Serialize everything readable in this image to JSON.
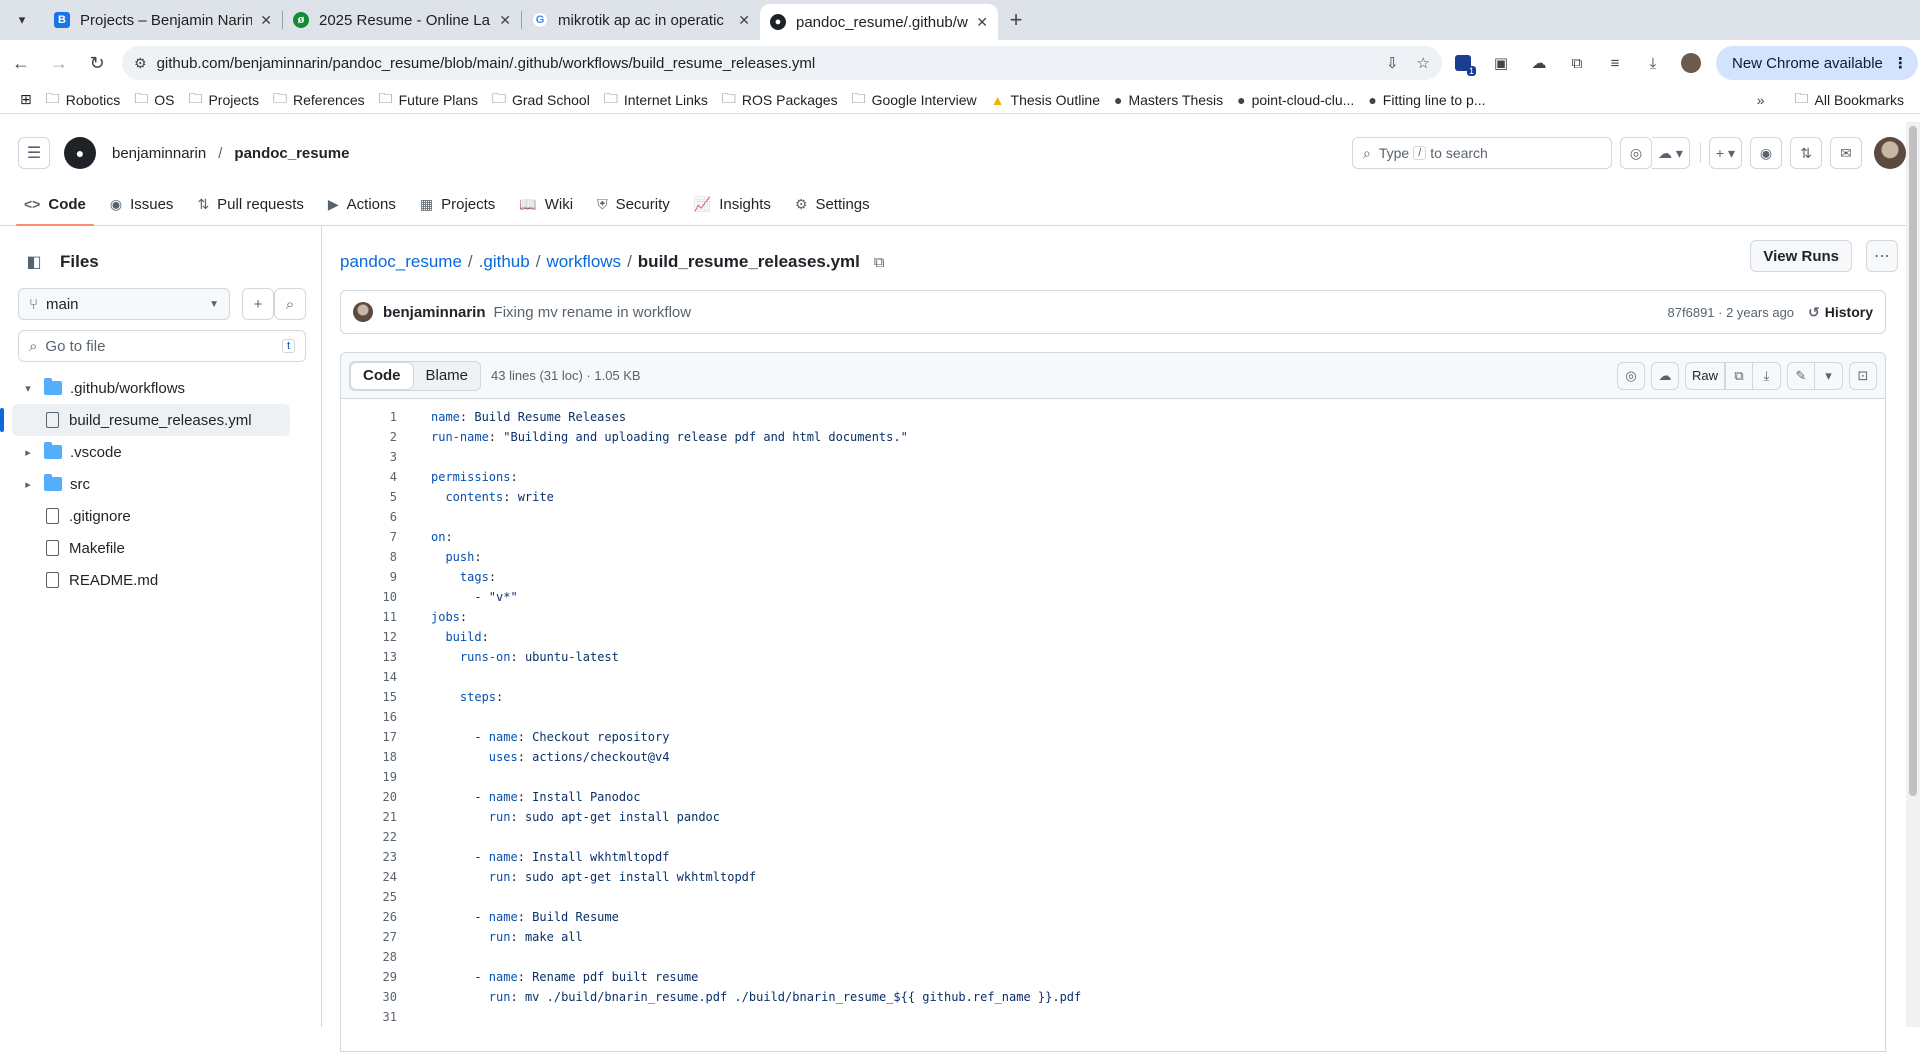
{
  "browser": {
    "tabs": [
      {
        "title": "Projects – Benjamin Narin",
        "favicon": "B",
        "color": "#1a73e8"
      },
      {
        "title": "2025 Resume - Online La",
        "favicon": "leaf-icon",
        "color": "#138a36"
      },
      {
        "title": "mikrotik ap ac in operatic",
        "favicon": "G",
        "color": "#4285f4"
      },
      {
        "title": "pandoc_resume/.github/w",
        "favicon": "github-icon",
        "color": "#1f2328"
      }
    ],
    "url": "github.com/benjaminnarin/pandoc_resume/blob/main/.github/workflows/build_resume_releases.yml",
    "update_label": "New Chrome available",
    "extension_badge": "1"
  },
  "bookmarks": {
    "items": [
      "Robotics",
      "OS",
      "Projects",
      "References",
      "Future Plans",
      "Grad School",
      "Internet Links",
      "ROS Packages",
      "Google Interview",
      "Thesis Outline",
      "Masters Thesis",
      "point-cloud-clu...",
      "Fitting line to p..."
    ],
    "all_label": "All Bookmarks"
  },
  "header": {
    "owner": "benjaminnarin",
    "repo": "pandoc_resume",
    "search_prefix": "Type",
    "search_key": "/",
    "search_suffix": "to search"
  },
  "repo_nav": [
    {
      "label": "Code",
      "icon": "code-icon"
    },
    {
      "label": "Issues",
      "icon": "issue-icon"
    },
    {
      "label": "Pull requests",
      "icon": "pull-request-icon"
    },
    {
      "label": "Actions",
      "icon": "play-icon"
    },
    {
      "label": "Projects",
      "icon": "table-icon"
    },
    {
      "label": "Wiki",
      "icon": "book-icon"
    },
    {
      "label": "Security",
      "icon": "shield-icon"
    },
    {
      "label": "Insights",
      "icon": "graph-icon"
    },
    {
      "label": "Settings",
      "icon": "gear-icon"
    }
  ],
  "sidebar": {
    "title": "Files",
    "branch": "main",
    "goto_placeholder": "Go to file",
    "goto_key": "t",
    "tree": [
      {
        "label": ".github/workflows",
        "kind": "folder",
        "expanded": true
      },
      {
        "label": "build_resume_releases.yml",
        "kind": "file",
        "selected": true
      },
      {
        "label": ".vscode",
        "kind": "folder"
      },
      {
        "label": "src",
        "kind": "folder"
      },
      {
        "label": ".gitignore",
        "kind": "file"
      },
      {
        "label": "Makefile",
        "kind": "file"
      },
      {
        "label": "README.md",
        "kind": "file"
      }
    ]
  },
  "breadcrumb": {
    "repo": "pandoc_resume",
    "dir1": ".github",
    "dir2": "workflows",
    "file": "build_resume_releases.yml"
  },
  "view_runs_label": "View Runs",
  "commit": {
    "author": "benjaminnarin",
    "message": "Fixing mv rename in workflow",
    "sha_age": "87f6891 · 2 years ago",
    "history_label": "History"
  },
  "file": {
    "tab_code": "Code",
    "tab_blame": "Blame",
    "meta": "43 lines (31 loc) · 1.05 KB",
    "raw_label": "Raw",
    "lines": [
      {
        "k": "name",
        "v": " Build Resume Releases",
        "indent": ""
      },
      {
        "k": "run-name",
        "v": " \"Building and uploading release pdf and html documents.\"",
        "indent": ""
      },
      {
        "k": "",
        "v": "",
        "indent": ""
      },
      {
        "k": "permissions",
        "v": "",
        "indent": ""
      },
      {
        "k": "contents",
        "v": " write",
        "indent": "  "
      },
      {
        "k": "",
        "v": "",
        "indent": ""
      },
      {
        "k": "on",
        "v": "",
        "indent": ""
      },
      {
        "k": "push",
        "v": "",
        "indent": "  "
      },
      {
        "k": "tags",
        "v": "",
        "indent": "    "
      },
      {
        "k": "",
        "v": "- \"v*\"",
        "indent": "      "
      },
      {
        "k": "jobs",
        "v": "",
        "indent": ""
      },
      {
        "k": "build",
        "v": "",
        "indent": "  "
      },
      {
        "k": "runs-on",
        "v": " ubuntu-latest",
        "indent": "    "
      },
      {
        "k": "",
        "v": "",
        "indent": ""
      },
      {
        "k": "steps",
        "v": "",
        "indent": "    "
      },
      {
        "k": "",
        "v": "",
        "indent": ""
      },
      {
        "k": "name",
        "v": " Checkout repository",
        "indent": "      - "
      },
      {
        "k": "uses",
        "v": " actions/checkout@v4",
        "indent": "        "
      },
      {
        "k": "",
        "v": "",
        "indent": ""
      },
      {
        "k": "name",
        "v": " Install Panodoc",
        "indent": "      - "
      },
      {
        "k": "run",
        "v": " sudo apt-get install pandoc",
        "indent": "        "
      },
      {
        "k": "",
        "v": "",
        "indent": ""
      },
      {
        "k": "name",
        "v": " Install wkhtmltopdf",
        "indent": "      - "
      },
      {
        "k": "run",
        "v": " sudo apt-get install wkhtmltopdf",
        "indent": "        "
      },
      {
        "k": "",
        "v": "",
        "indent": ""
      },
      {
        "k": "name",
        "v": " Build Resume",
        "indent": "      - "
      },
      {
        "k": "run",
        "v": " make all",
        "indent": "        "
      },
      {
        "k": "",
        "v": "",
        "indent": ""
      },
      {
        "k": "name",
        "v": " Rename pdf built resume",
        "indent": "      - "
      },
      {
        "k": "run",
        "v": " mv ./build/bnarin_resume.pdf ./build/bnarin_resume_${{ github.ref_name }}.pdf",
        "indent": "        "
      },
      {
        "k": "",
        "v": "",
        "indent": ""
      }
    ]
  }
}
